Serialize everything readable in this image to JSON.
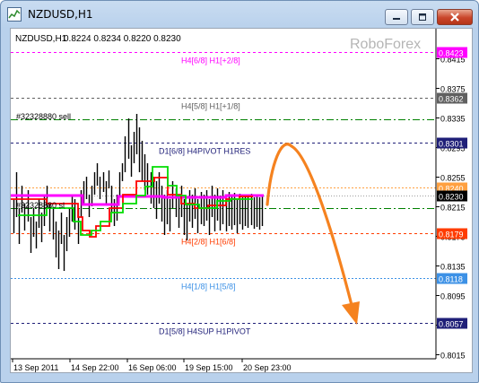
{
  "window": {
    "title": "NZDUSD,H1"
  },
  "chart_header": {
    "symbol": "NZDUSD,H1",
    "ohlc": "0.8224 0.8234 0.8220 0.8230"
  },
  "watermark": "RoboForex",
  "colors": {
    "magenta": "#ff00ff",
    "dark_gray": "#606060",
    "green_line": "#008000",
    "navy": "#1f1f78",
    "orange": "#ff6a00",
    "light_orange": "#ff9b3a",
    "dodger": "#3c91e6",
    "candles": "#000000",
    "red_line": "#ff0000",
    "bright_green": "#00dd00",
    "arrow": "#f5821f"
  },
  "levels": [
    {
      "price": 0.8423,
      "label": "H4[6/8] H1[+2/8]",
      "color": "#ff00ff",
      "dash": "3,3",
      "badge": "0.8423"
    },
    {
      "price": 0.8362,
      "label": "H4[5/8] H1[+1/8]",
      "color": "#606060",
      "dash": "3,3",
      "badge": "0.8362"
    },
    {
      "price": 0.8332,
      "label": "",
      "color": "#008000",
      "dash": "8,3,2,3",
      "badge": ""
    },
    {
      "price": 0.8301,
      "label": "D1[6/8] H4PIVOT H1RES",
      "color": "#1f1f78",
      "dash": "3,3",
      "badge": "0.8301"
    },
    {
      "price": 0.824,
      "label": "",
      "color": "#ffa040",
      "dash": "2,2",
      "badge": "0.8240"
    },
    {
      "price": 0.8213,
      "label": "",
      "color": "#008000",
      "dash": "8,3,2,3",
      "badge": ""
    },
    {
      "price": 0.8179,
      "label": "H4[2/8] H1[6/8]",
      "color": "#ff3c00",
      "dash": "3,3",
      "badge": "0.8179"
    },
    {
      "price": 0.8118,
      "label": "H4[1/8] H1[5/8]",
      "color": "#3c91e6",
      "dash": "2,2",
      "badge": "0.8118"
    },
    {
      "price": 0.8057,
      "label": "D1[5/8] H4SUP H1PIVOT",
      "color": "#1f1f78",
      "dash": "3,3",
      "badge": "0.8057"
    }
  ],
  "current_price": {
    "price": 0.823,
    "badge": "0.8230"
  },
  "orders": [
    {
      "text": "#32328880 sell"
    },
    {
      "text": "#32328880 sl"
    }
  ],
  "price_axis_ticks": [
    "0.8415",
    "0.8375",
    "0.8335",
    "0.8295",
    "0.8255",
    "0.8215",
    "0.8175",
    "0.8135",
    "0.8095",
    "0.8055",
    "0.8015"
  ],
  "time_axis_ticks": [
    "13 Sep 2011",
    "14 Sep 22:00",
    "16 Sep 06:00",
    "19 Sep 15:00",
    "20 Sep 23:00"
  ]
}
